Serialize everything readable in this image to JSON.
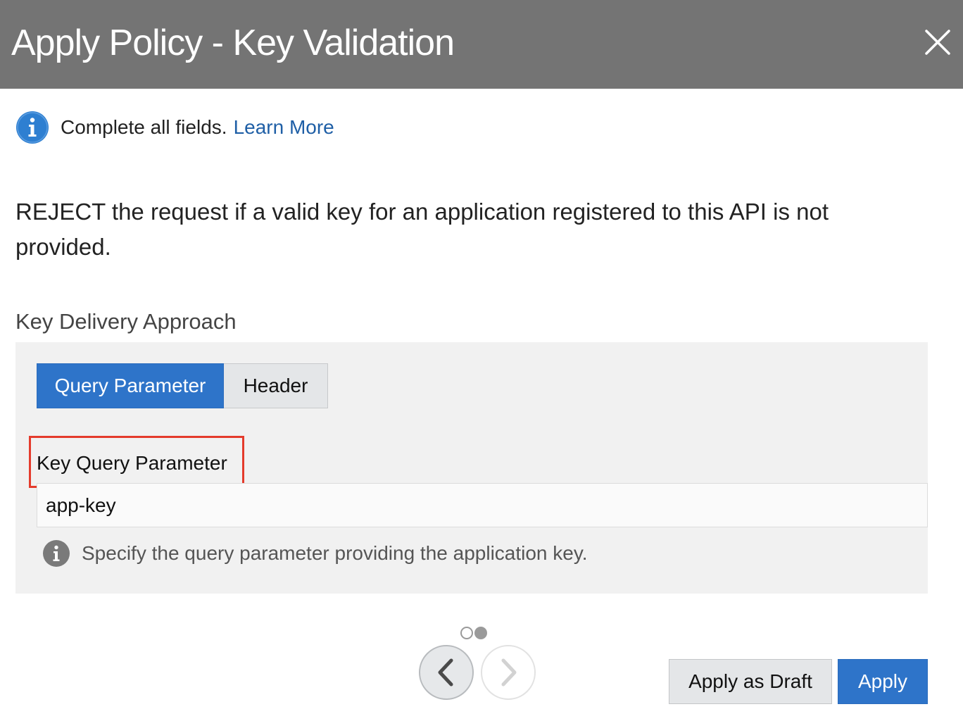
{
  "dialog": {
    "title": "Apply Policy - Key Validation",
    "close_icon": "close-icon"
  },
  "info": {
    "icon": "info-icon",
    "text": "Complete all fields.",
    "link": "Learn More",
    "link_color": "#1f5fa6"
  },
  "description": "REJECT the request if a valid key for an application registered to this API is not provided.",
  "key_delivery": {
    "label": "Key Delivery Approach",
    "options": [
      "Query Parameter",
      "Header"
    ],
    "selected": "Query Parameter",
    "field_label": "Key Query Parameter",
    "field_value": "app-key",
    "hint_icon": "info-icon",
    "hint": "Specify the query parameter providing the application key."
  },
  "pager": {
    "pages": 2,
    "prev_icon": "chevron-left-icon",
    "next_icon": "chevron-right-icon"
  },
  "footer": {
    "draft_label": "Apply as Draft",
    "apply_label": "Apply"
  },
  "colors": {
    "header_bg": "#747474",
    "accent": "#2e74c9",
    "highlight_border": "#e43b2c",
    "panel_bg": "#f1f1f1"
  }
}
